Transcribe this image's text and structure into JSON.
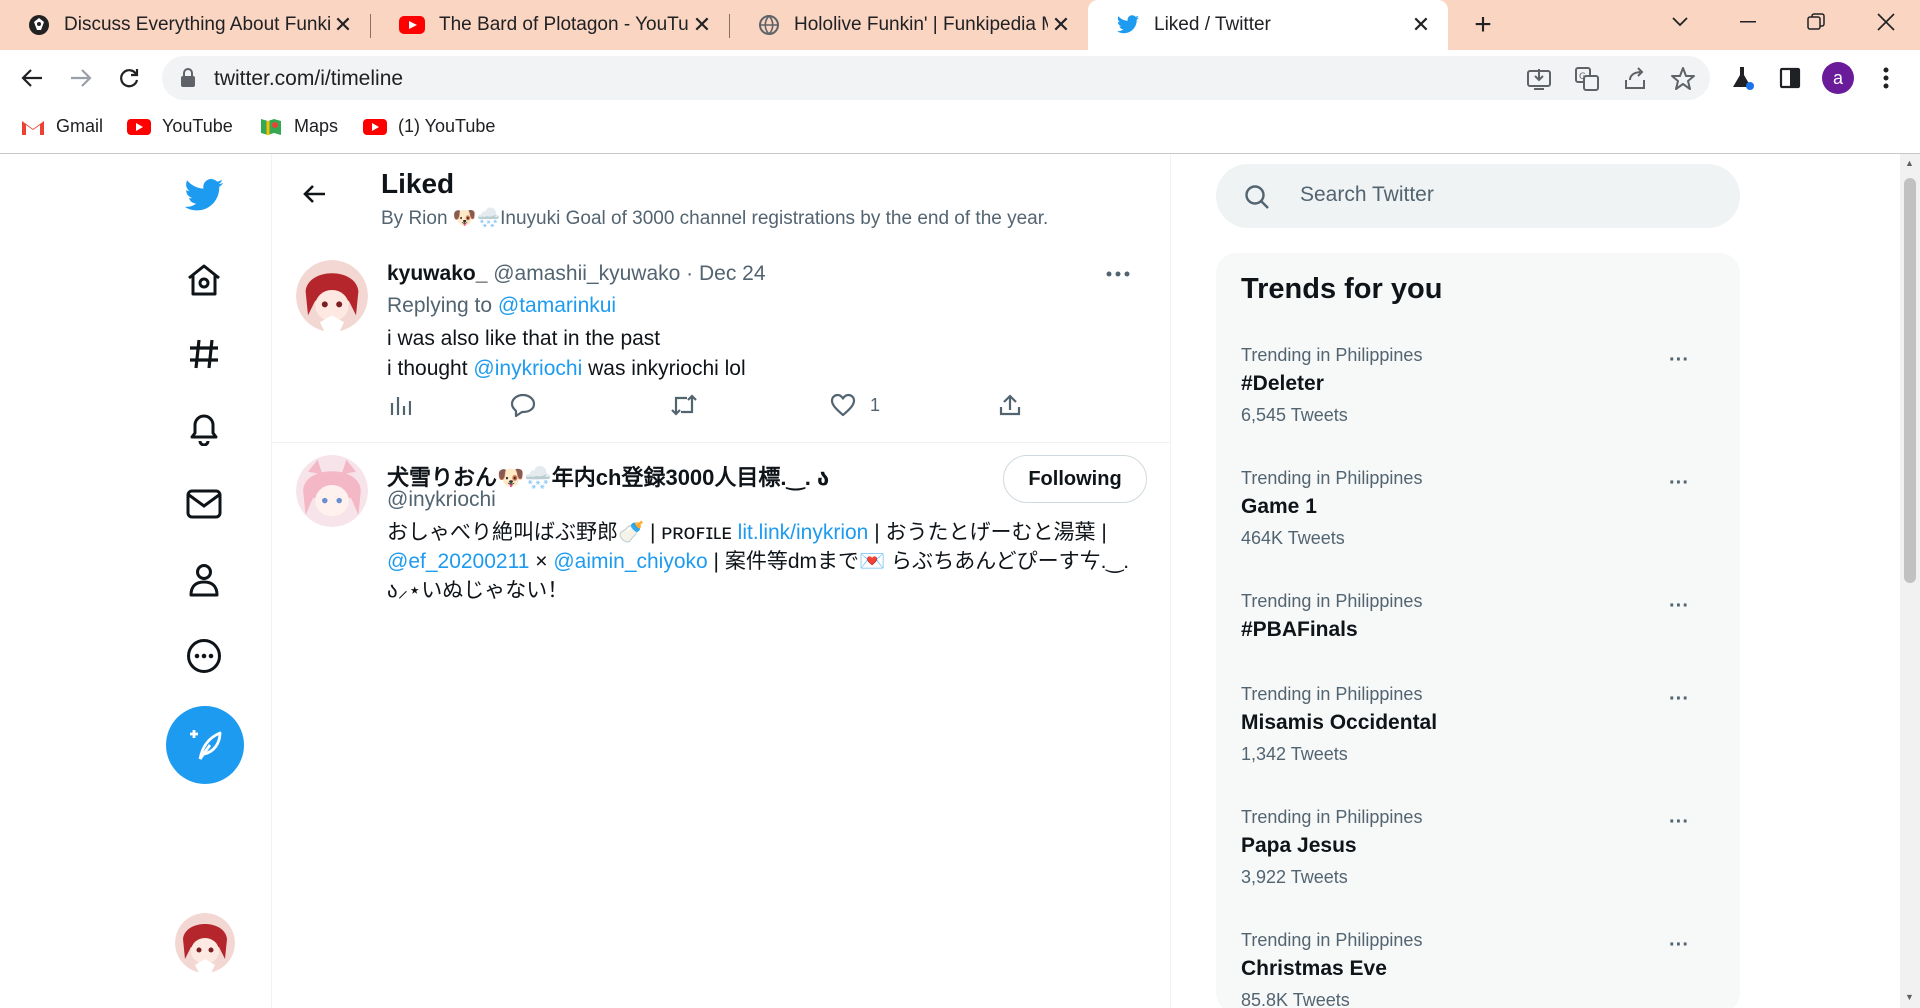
{
  "browser": {
    "tabs": [
      {
        "title": "Discuss Everything About Funkipedia",
        "icon": "funkipedia-icon"
      },
      {
        "title": "The Bard of Plotagon - YouTube",
        "icon": "youtube-icon"
      },
      {
        "title": "Hololive Funkin' | Funkipedia Mods",
        "icon": "globe-icon"
      },
      {
        "title": "Liked / Twitter",
        "icon": "twitter-icon",
        "active": true
      }
    ],
    "url": "twitter.com/i/timeline",
    "profile_initial": "a",
    "bookmarks": [
      {
        "label": "Gmail",
        "icon": "gmail-icon"
      },
      {
        "label": "YouTube",
        "icon": "youtube-icon"
      },
      {
        "label": "Maps",
        "icon": "maps-icon"
      },
      {
        "label": "(1) YouTube",
        "icon": "youtube-icon"
      }
    ]
  },
  "header": {
    "title": "Liked",
    "subtitle": "By Rion 🐶🌨️Inuyuki Goal of 3000 channel registrations by the end of the year."
  },
  "tweet": {
    "name": "kyuwako_",
    "handle": "@amashii_kyuwako",
    "separator": "·",
    "date": "Dec 24",
    "replying_prefix": "Replying to ",
    "replying_to": "@tamarinkui",
    "line1": "i was also like that in the past",
    "line2_pre": "i thought ",
    "line2_mention": "@inykriochi",
    "line2_post": " was inkyriochi lol",
    "like_count": "1"
  },
  "user_cell": {
    "name": "犬雪りおん🐶🌨️年内ch登録3000人目標.‿. ა",
    "handle": "@inykriochi",
    "follow_label": "Following",
    "bio_1": "おしゃべり絶叫ばぶ野郎🍼 | ᴘʀᴏꜰɪʟᴇ ",
    "bio_link1": "lit.link/inykrion",
    "bio_2": " | おうたとげーむと湯葉 | ",
    "bio_link2": "@ef_20200211",
    "bio_3": " × ",
    "bio_link3": "@aimin_chiyoko",
    "bio_4": " | 案件等dmまで💌 らぶちあんどぴーすㄘ.‿. ა⸝⋆いぬじゃない！"
  },
  "sidebar": {
    "search_placeholder": "Search Twitter",
    "trends_title": "Trends for you",
    "trends": [
      {
        "context": "Trending in Philippines",
        "name": "#Deleter",
        "count": "6,545 Tweets"
      },
      {
        "context": "Trending in Philippines",
        "name": "Game 1",
        "count": "464K Tweets"
      },
      {
        "context": "Trending in Philippines",
        "name": "#PBAFinals",
        "count": ""
      },
      {
        "context": "Trending in Philippines",
        "name": "Misamis Occidental",
        "count": "1,342 Tweets"
      },
      {
        "context": "Trending in Philippines",
        "name": "Papa Jesus",
        "count": "3,922 Tweets"
      },
      {
        "context": "Trending in Philippines",
        "name": "Christmas Eve",
        "count": "85.8K Tweets"
      }
    ],
    "more_glyph": "···"
  },
  "colors": {
    "accent": "#1d9bf0",
    "tabbar": "#f9d5c2",
    "muted": "#536471"
  }
}
